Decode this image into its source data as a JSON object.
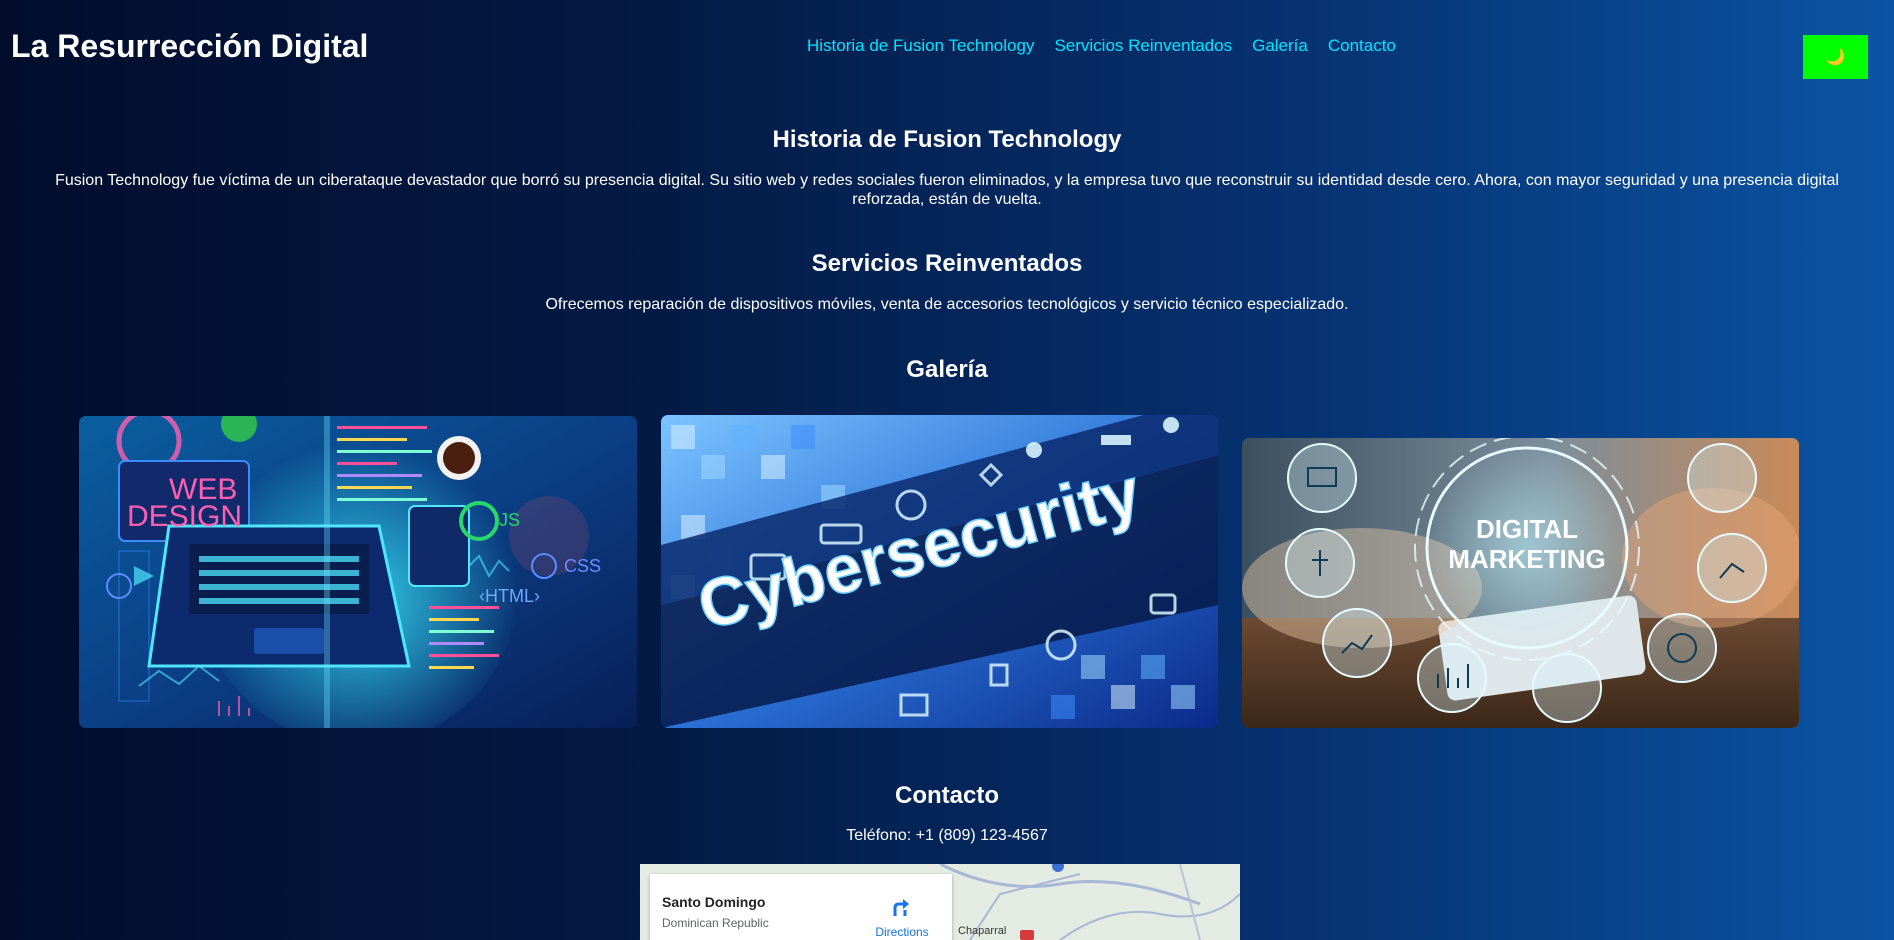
{
  "header": {
    "title": "La Resurrección Digital",
    "nav": [
      "Historia de Fusion Technology",
      "Servicios Reinventados",
      "Galería",
      "Contacto"
    ],
    "theme_toggle_icon": "🌙",
    "theme_toggle_color": "#00ff00"
  },
  "historia": {
    "heading": "Historia de Fusion Technology",
    "text": "Fusion Technology fue víctima de un ciberataque devastador que borró su presencia digital. Su sitio web y redes sociales fueron eliminados, y la empresa tuvo que reconstruir su identidad desde cero. Ahora, con mayor seguridad y una presencia digital reforzada, están de vuelta."
  },
  "servicios": {
    "heading": "Servicios Reinventados",
    "text": "Ofrecemos reparación de dispositivos móviles, venta de accesorios tecnológicos y servicio técnico especializado."
  },
  "galeria": {
    "heading": "Galería",
    "images": [
      {
        "caption_lines": [
          "WEB",
          "DESIGN"
        ],
        "tags": [
          "JS",
          "CSS",
          "‹HTML›"
        ]
      },
      {
        "caption": "Cybersecurity"
      },
      {
        "caption_lines": [
          "DIGITAL",
          "MARKETING"
        ]
      }
    ]
  },
  "contacto": {
    "heading": "Contacto",
    "phone": "Teléfono: +1 (809) 123-4567"
  },
  "map": {
    "place": "Santo Domingo",
    "country": "Dominican Republic",
    "directions": "Directions",
    "label": "Chaparral"
  },
  "colors": {
    "nav_link": "#00e5ff",
    "accent_green": "#00ff00",
    "text": "#ffffff"
  }
}
